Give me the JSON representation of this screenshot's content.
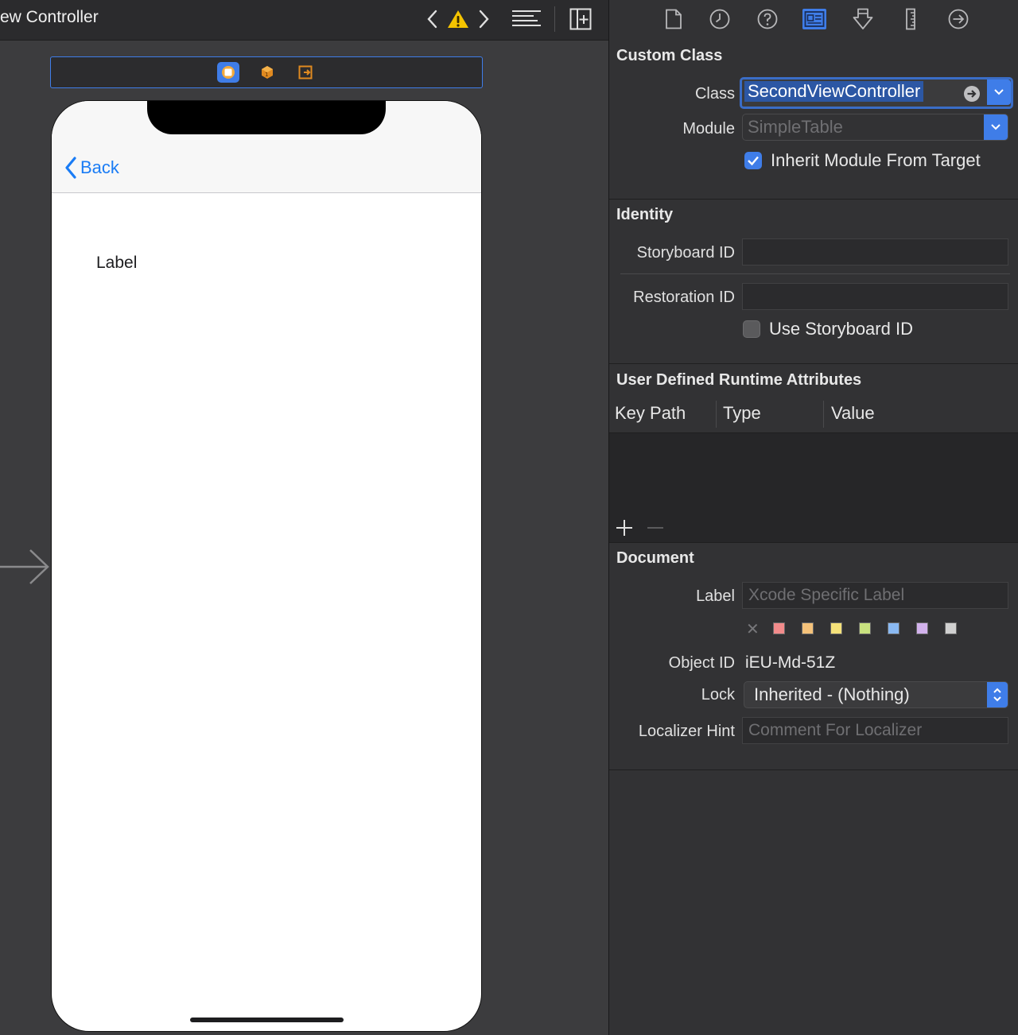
{
  "canvas": {
    "title": "ew Controller",
    "ui_label": "Label",
    "back_label": "Back"
  },
  "inspector": {
    "custom_class": {
      "title": "Custom Class",
      "class_label": "Class",
      "class_value": "SecondViewController",
      "module_label": "Module",
      "module_placeholder": "SimpleTable",
      "inherit_label": "Inherit Module From Target",
      "inherit_checked": true
    },
    "identity": {
      "title": "Identity",
      "storyboard_id_label": "Storyboard ID",
      "storyboard_id_value": "",
      "restoration_id_label": "Restoration ID",
      "restoration_id_value": "",
      "use_storyboard_id_label": "Use Storyboard ID",
      "use_storyboard_id_checked": false
    },
    "uda": {
      "title": "User Defined Runtime Attributes",
      "columns": [
        "Key Path",
        "Type",
        "Value"
      ]
    },
    "document": {
      "title": "Document",
      "label_label": "Label",
      "label_placeholder": "Xcode Specific Label",
      "swatch_colors": [
        "#f28b8b",
        "#f5c27a",
        "#f5e27a",
        "#c9e27f",
        "#8ab9f2",
        "#d2b2ec",
        "#d0d0d0"
      ],
      "object_id_label": "Object ID",
      "object_id_value": "iEU-Md-51Z",
      "lock_label": "Lock",
      "lock_value": "Inherited - (Nothing)",
      "localizer_hint_label": "Localizer Hint",
      "localizer_hint_placeholder": "Comment For Localizer"
    }
  },
  "colors": {
    "accent": "#3f7de8",
    "ios_tint": "#1a7cf5",
    "warning": "#f5c400"
  }
}
